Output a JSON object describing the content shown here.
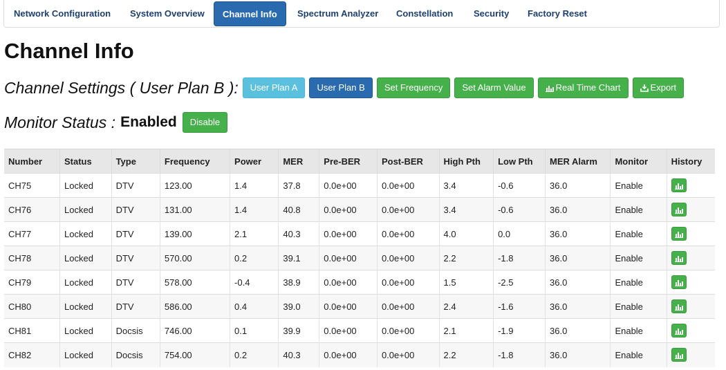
{
  "nav": {
    "tabs": [
      {
        "label": "Network Configuration"
      },
      {
        "label": "System Overview"
      },
      {
        "label": "Channel Info"
      },
      {
        "label": "Spectrum Analyzer"
      },
      {
        "label": "Constellation"
      },
      {
        "label": "Security"
      },
      {
        "label": "Factory Reset"
      }
    ],
    "active_tab": "Channel Info"
  },
  "page": {
    "title": "Channel Info"
  },
  "settings": {
    "label": "Channel Settings ( User Plan B ):",
    "buttons": {
      "user_plan_a": "User Plan A",
      "user_plan_b": "User Plan B",
      "set_frequency": "Set Frequency",
      "set_alarm_value": "Set Alarm Value",
      "real_time_chart": "Real Time Chart",
      "export": "Export"
    }
  },
  "monitor": {
    "label": "Monitor Status :",
    "value": "Enabled",
    "disable_button": "Disable"
  },
  "table": {
    "headers": [
      "Number",
      "Status",
      "Type",
      "Frequency",
      "Power",
      "MER",
      "Pre-BER",
      "Post-BER",
      "High Pth",
      "Low Pth",
      "MER Alarm",
      "Monitor",
      "History"
    ],
    "rows": [
      [
        "CH75",
        "Locked",
        "DTV",
        "123.00",
        "1.4",
        "37.8",
        "0.0e+00",
        "0.0e+00",
        "3.4",
        "-0.6",
        "36.0",
        "Enable"
      ],
      [
        "CH76",
        "Locked",
        "DTV",
        "131.00",
        "1.4",
        "40.8",
        "0.0e+00",
        "0.0e+00",
        "3.4",
        "-0.6",
        "36.0",
        "Enable"
      ],
      [
        "CH77",
        "Locked",
        "DTV",
        "139.00",
        "2.1",
        "40.3",
        "0.0e+00",
        "0.0e+00",
        "4.0",
        "0.0",
        "36.0",
        "Enable"
      ],
      [
        "CH78",
        "Locked",
        "DTV",
        "570.00",
        "0.2",
        "39.1",
        "0.0e+00",
        "0.0e+00",
        "2.2",
        "-1.8",
        "36.0",
        "Enable"
      ],
      [
        "CH79",
        "Locked",
        "DTV",
        "578.00",
        "-0.4",
        "38.9",
        "0.0e+00",
        "0.0e+00",
        "1.5",
        "-2.5",
        "36.0",
        "Enable"
      ],
      [
        "CH80",
        "Locked",
        "DTV",
        "586.00",
        "0.4",
        "39.0",
        "0.0e+00",
        "0.0e+00",
        "2.4",
        "-1.6",
        "36.0",
        "Enable"
      ],
      [
        "CH81",
        "Locked",
        "Docsis",
        "746.00",
        "0.1",
        "39.9",
        "0.0e+00",
        "0.0e+00",
        "2.1",
        "-1.9",
        "36.0",
        "Enable"
      ],
      [
        "CH82",
        "Locked",
        "Docsis",
        "754.00",
        "0.2",
        "40.3",
        "0.0e+00",
        "0.0e+00",
        "2.2",
        "-1.8",
        "36.0",
        "Enable"
      ]
    ],
    "history_icon": "bar-chart-icon"
  },
  "colors": {
    "primary": "#2a6bb0",
    "info": "#5bc0de",
    "success": "#46b14a",
    "nav_text": "#1d3f72",
    "header_bg": "#e7e7e7"
  }
}
